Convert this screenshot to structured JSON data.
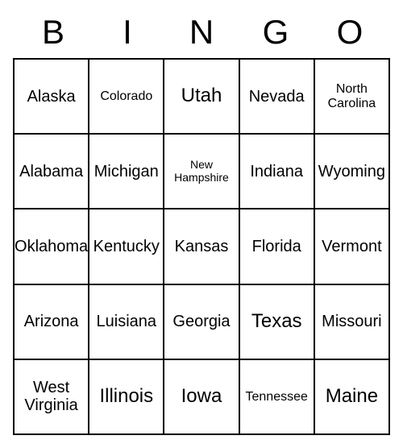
{
  "header": [
    "B",
    "I",
    "N",
    "G",
    "O"
  ],
  "grid": [
    [
      {
        "text": "Alaska",
        "size": ""
      },
      {
        "text": "Colorado",
        "size": "small"
      },
      {
        "text": "Utah",
        "size": "large"
      },
      {
        "text": "Nevada",
        "size": ""
      },
      {
        "text": "North Carolina",
        "size": "small"
      }
    ],
    [
      {
        "text": "Alabama",
        "size": ""
      },
      {
        "text": "Michigan",
        "size": ""
      },
      {
        "text": "New Hampshire",
        "size": "xsmall"
      },
      {
        "text": "Indiana",
        "size": ""
      },
      {
        "text": "Wyoming",
        "size": ""
      }
    ],
    [
      {
        "text": "Oklahoma",
        "size": ""
      },
      {
        "text": "Kentucky",
        "size": ""
      },
      {
        "text": "Kansas",
        "size": ""
      },
      {
        "text": "Florida",
        "size": ""
      },
      {
        "text": "Vermont",
        "size": ""
      }
    ],
    [
      {
        "text": "Arizona",
        "size": ""
      },
      {
        "text": "Luisiana",
        "size": ""
      },
      {
        "text": "Georgia",
        "size": ""
      },
      {
        "text": "Texas",
        "size": "large"
      },
      {
        "text": "Missouri",
        "size": ""
      }
    ],
    [
      {
        "text": "West Virginia",
        "size": ""
      },
      {
        "text": "Illinois",
        "size": "large"
      },
      {
        "text": "Iowa",
        "size": "large"
      },
      {
        "text": "Tennessee",
        "size": "small"
      },
      {
        "text": "Maine",
        "size": "large"
      }
    ]
  ]
}
